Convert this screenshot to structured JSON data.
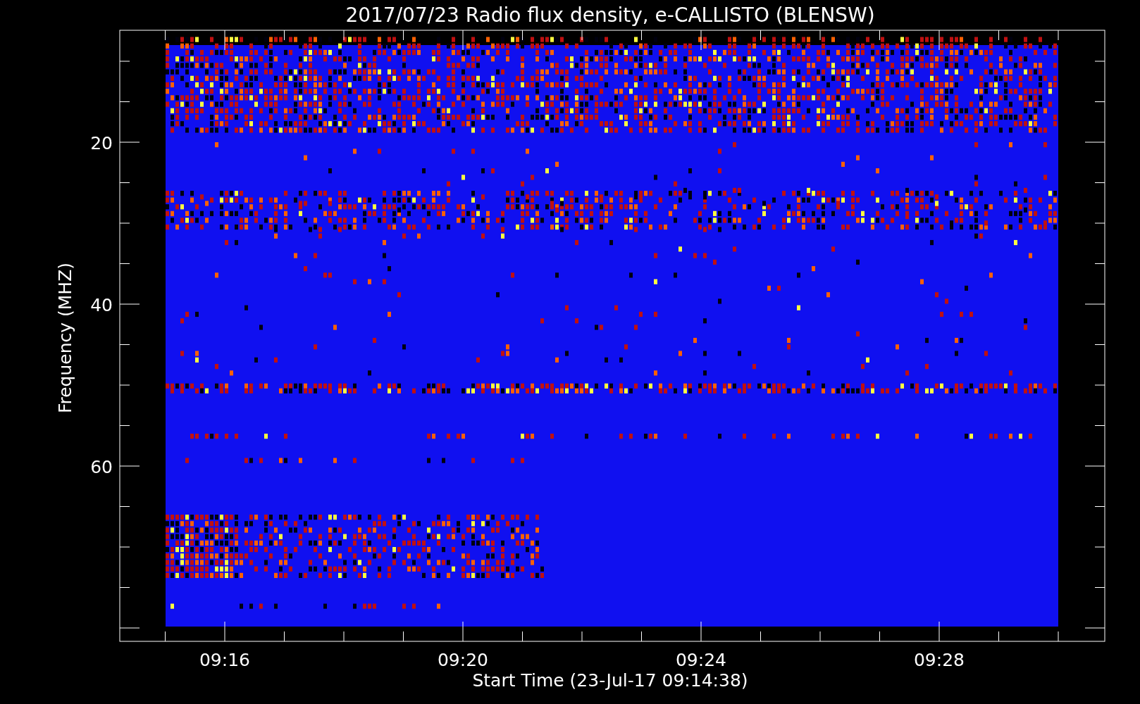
{
  "title": "2017/07/23  Radio flux density, e-CALLISTO (BLENSW)",
  "ylabel": "Frequency (MHZ)",
  "xlabel": "Start Time (23-Jul-17 09:14:38)",
  "yticks": [
    "20",
    "40",
    "60"
  ],
  "xticks": [
    "09:16",
    "09:20",
    "09:24",
    "09:28"
  ]
}
